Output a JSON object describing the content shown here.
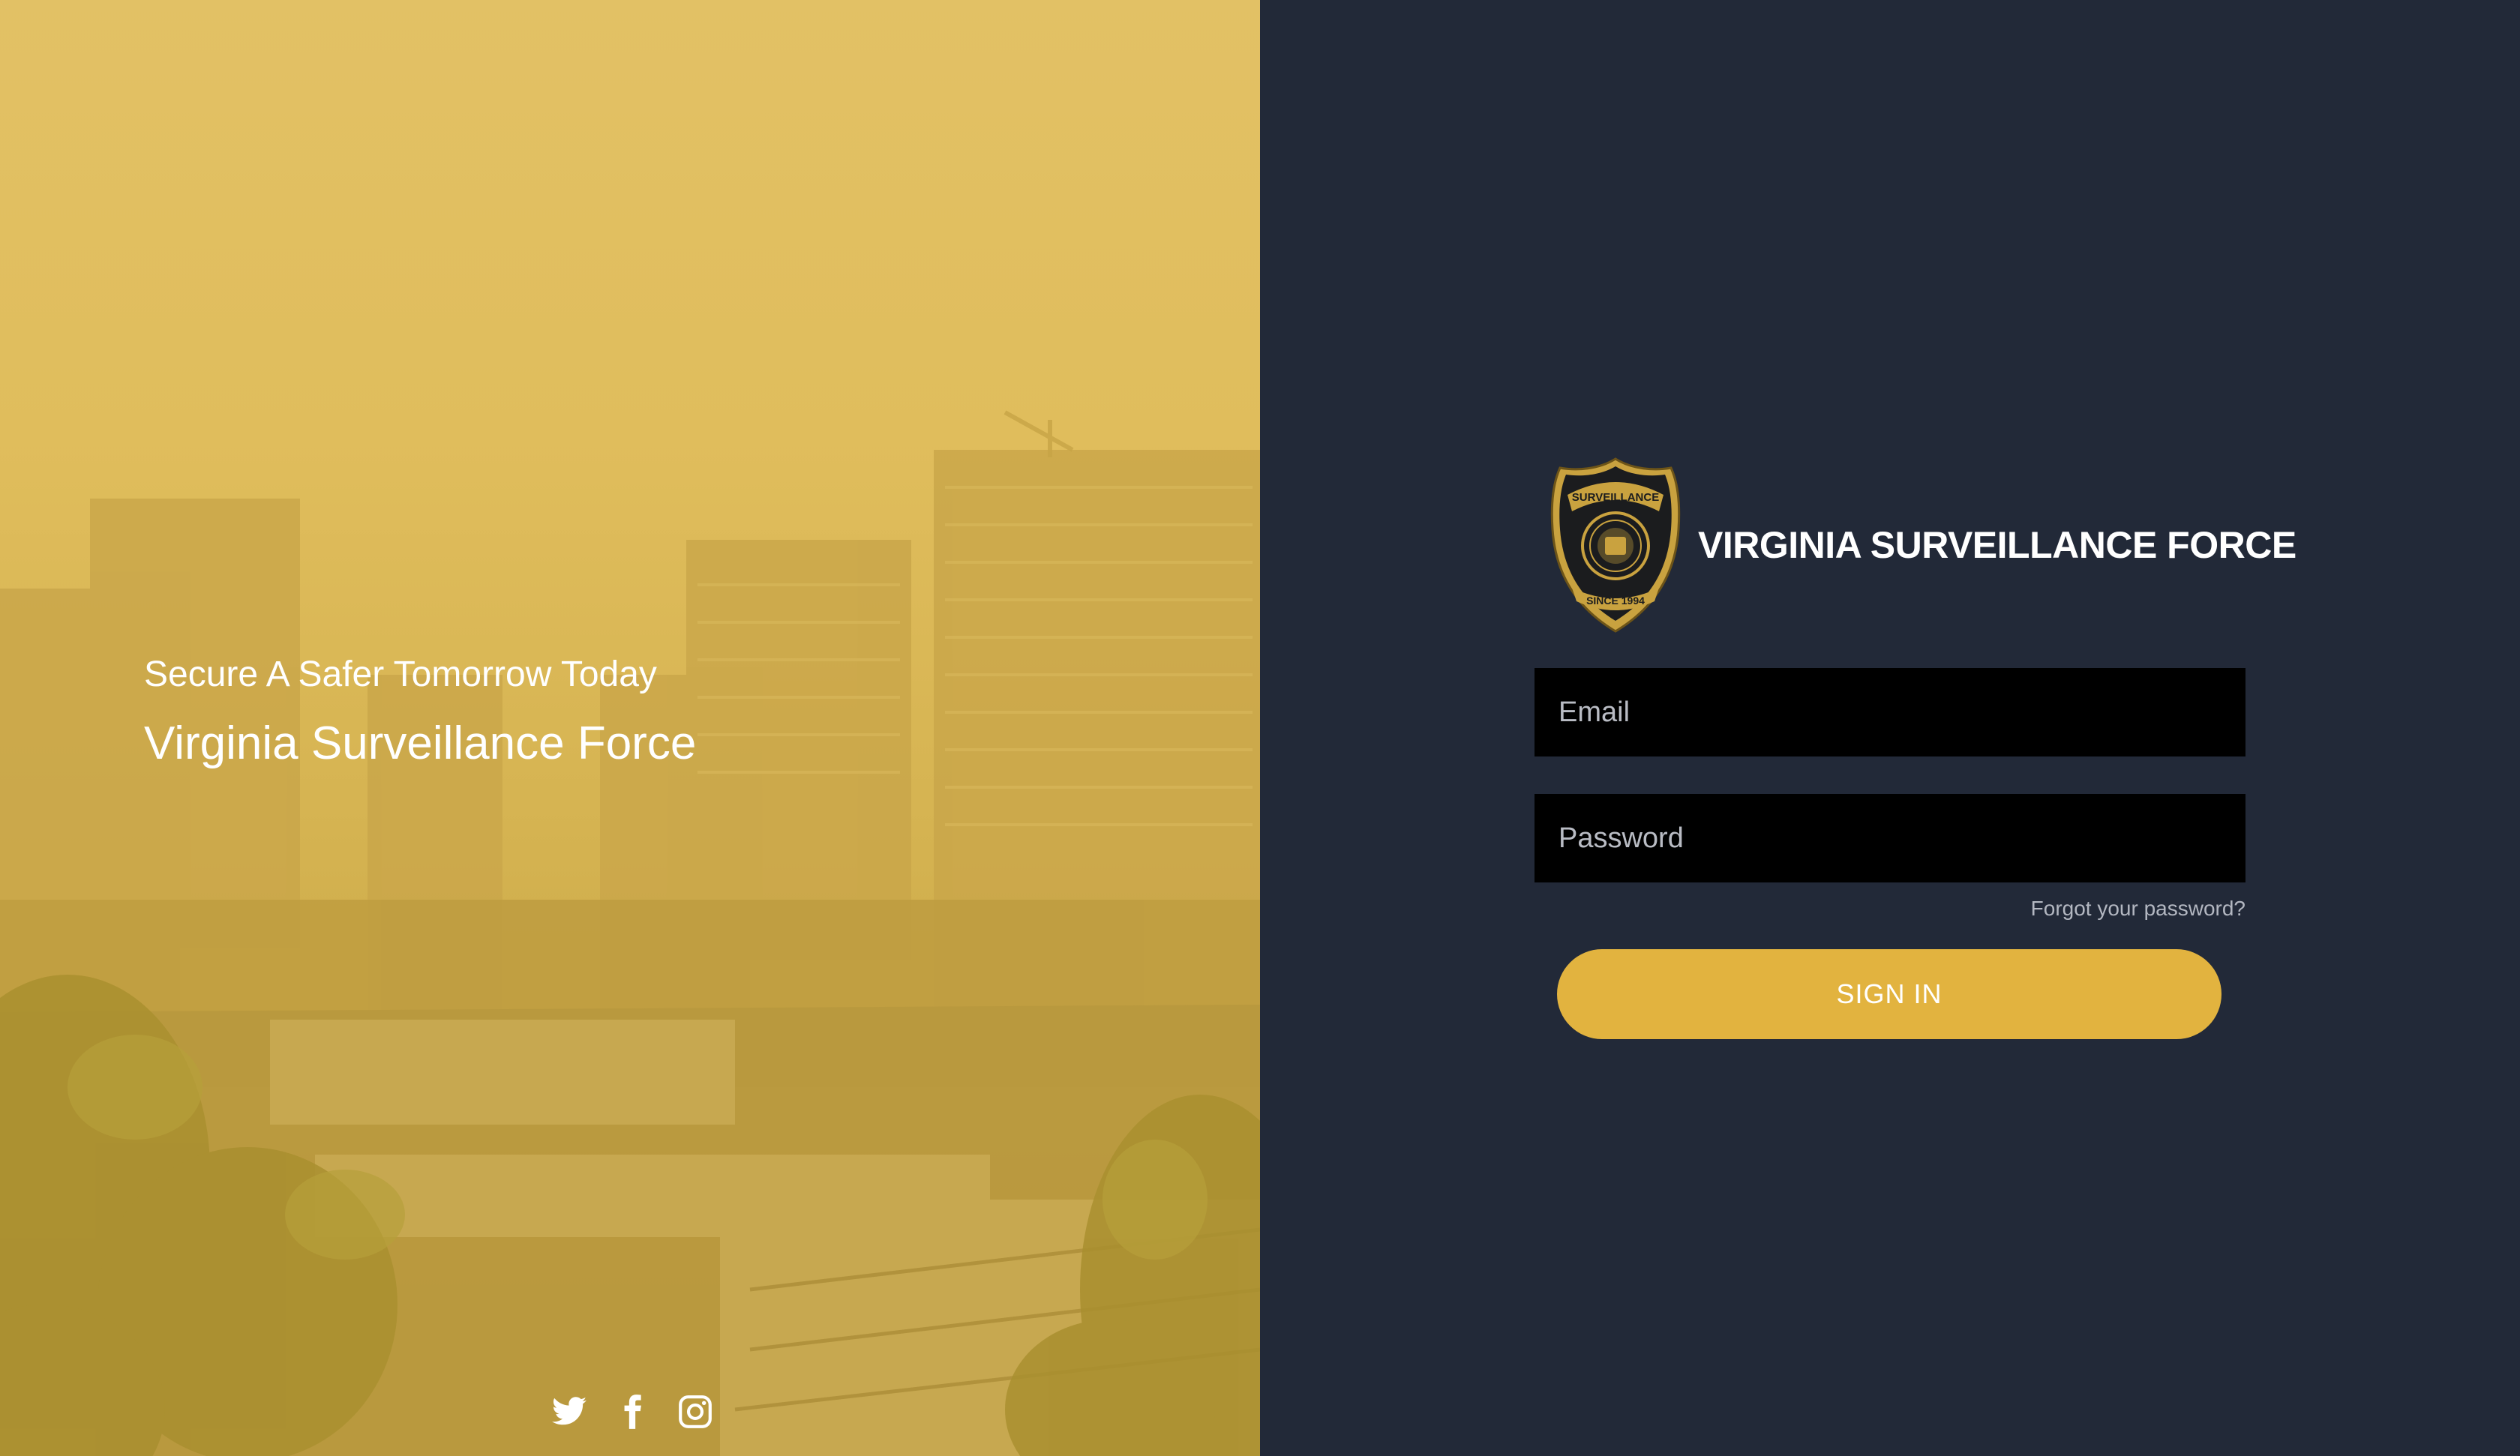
{
  "hero": {
    "tagline": "Secure A Safer Tomorrow Today",
    "title": "Virginia Surveillance Force",
    "overlay_color": "#e0bd5c"
  },
  "social": [
    {
      "name": "twitter-icon"
    },
    {
      "name": "facebook-icon"
    },
    {
      "name": "instagram-icon"
    }
  ],
  "brand": {
    "name": "VIRGINIA SURVEILLANCE FORCE",
    "badge_top_text": "SURVEILLANCE",
    "badge_bottom_text": "SINCE 1994"
  },
  "form": {
    "email_placeholder": "Email",
    "password_placeholder": "Password",
    "forgot_label": "Forgot your password?",
    "signin_label": "SIGN IN"
  },
  "colors": {
    "panel_bg": "#222938",
    "accent": "#e2b33f",
    "input_bg": "#000000"
  }
}
